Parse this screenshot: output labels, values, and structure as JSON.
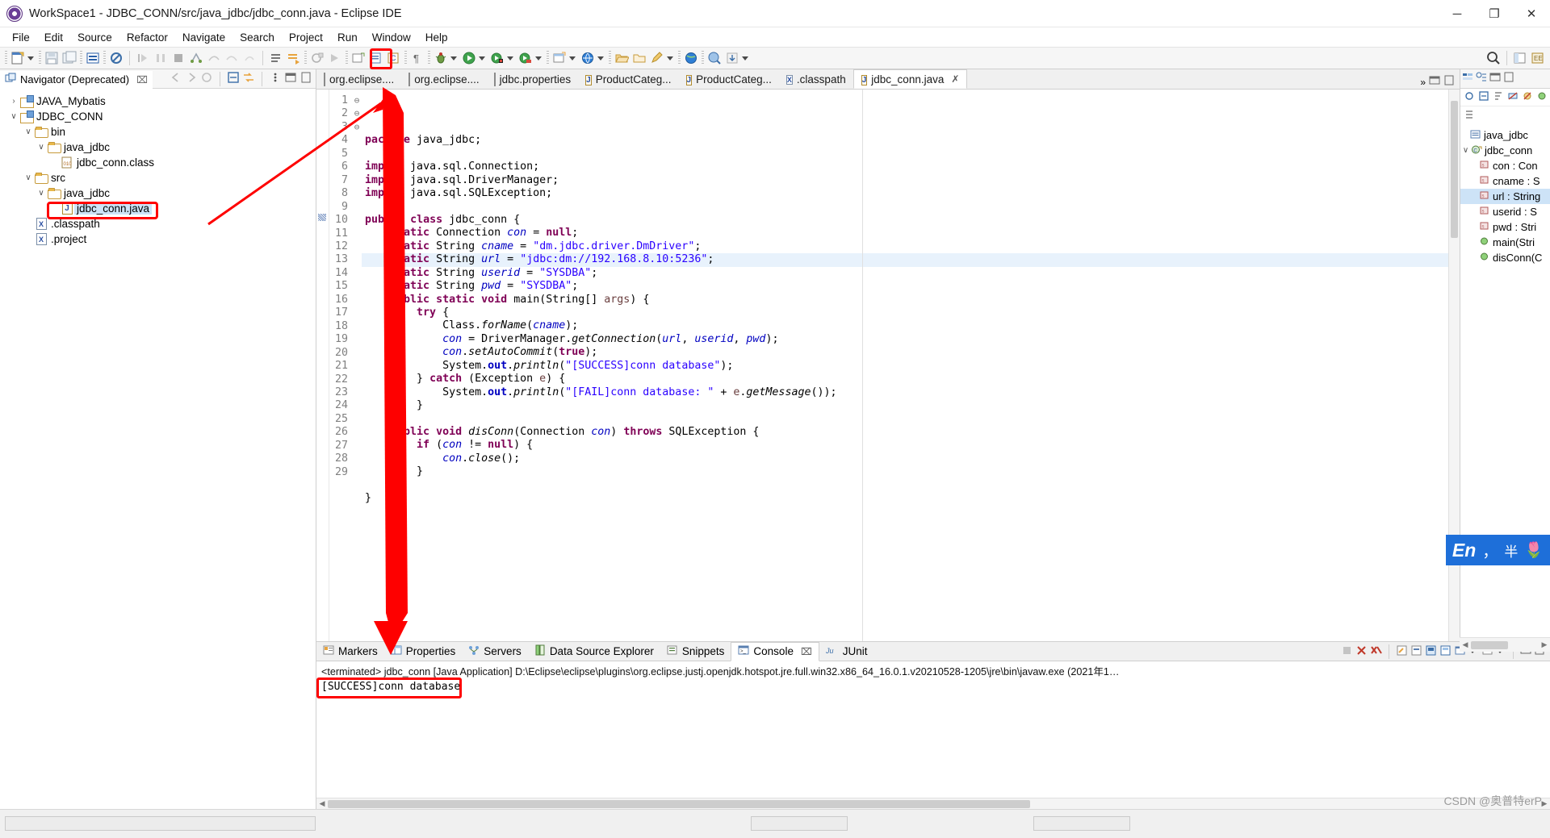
{
  "window": {
    "title": "WorkSpace1 - JDBC_CONN/src/java_jdbc/jdbc_conn.java - Eclipse IDE",
    "minimize": "─",
    "maximize": "❐",
    "close": "✕"
  },
  "menubar": [
    {
      "label": "File"
    },
    {
      "label": "Edit"
    },
    {
      "label": "Source"
    },
    {
      "label": "Refactor"
    },
    {
      "label": "Navigate"
    },
    {
      "label": "Search"
    },
    {
      "label": "Project"
    },
    {
      "label": "Run"
    },
    {
      "label": "Window"
    },
    {
      "label": "Help"
    }
  ],
  "toolbar": {
    "highlight_color": "#fe0000",
    "items": [
      {
        "name": "new-wizard-icon"
      },
      {
        "name": "save-icon"
      },
      {
        "name": "save-all-icon"
      },
      {
        "name": "print-icon"
      },
      {
        "name": "undo-icon"
      },
      {
        "name": "redo-icon"
      },
      {
        "name": "debug-icon"
      },
      {
        "name": "run-icon"
      },
      {
        "name": "run-external-tools-icon"
      },
      {
        "name": "new-java-project-icon"
      },
      {
        "name": "new-class-icon"
      },
      {
        "name": "open-type-icon"
      },
      {
        "name": "search-icon"
      }
    ]
  },
  "navigator": {
    "tab_label": "Navigator (Deprecated)",
    "close_glyph": "⌧",
    "tree": [
      {
        "label": "JAVA_Mybatis",
        "depth": 0,
        "twist": "›",
        "icon": "project-icon",
        "selected": false
      },
      {
        "label": "JDBC_CONN",
        "depth": 0,
        "twist": "∨",
        "icon": "project-icon",
        "selected": false
      },
      {
        "label": "bin",
        "depth": 1,
        "twist": "∨",
        "icon": "folder-icon",
        "selected": false
      },
      {
        "label": "java_jdbc",
        "depth": 2,
        "twist": "∨",
        "icon": "folder-icon",
        "selected": false
      },
      {
        "label": "jdbc_conn.class",
        "depth": 3,
        "twist": "",
        "icon": "class-file-icon",
        "selected": false
      },
      {
        "label": "src",
        "depth": 1,
        "twist": "∨",
        "icon": "folder-icon",
        "selected": false
      },
      {
        "label": "java_jdbc",
        "depth": 2,
        "twist": "∨",
        "icon": "folder-icon",
        "selected": false
      },
      {
        "label": "jdbc_conn.java",
        "depth": 3,
        "twist": "",
        "icon": "java-file-icon",
        "selected": true
      },
      {
        "label": ".classpath",
        "depth": 1,
        "twist": "",
        "icon": "xml-file-icon",
        "selected": false
      },
      {
        "label": ".project",
        "depth": 1,
        "twist": "",
        "icon": "xml-file-icon",
        "selected": false
      }
    ]
  },
  "editor": {
    "tabs": [
      {
        "label": "org.eclipse....",
        "icon": "text-file-icon",
        "active": false
      },
      {
        "label": "org.eclipse....",
        "icon": "text-file-icon",
        "active": false
      },
      {
        "label": "jdbc.properties",
        "icon": "text-file-icon",
        "active": false
      },
      {
        "label": "ProductCateg...",
        "icon": "java-file-icon",
        "active": false
      },
      {
        "label": "ProductCateg...",
        "icon": "java-file-icon",
        "active": false
      },
      {
        "label": ".classpath",
        "icon": "xml-file-icon",
        "active": false
      },
      {
        "label": "jdbc_conn.java",
        "icon": "java-file-icon",
        "active": true
      }
    ],
    "overflow_label": "»",
    "highlighted_line": 10,
    "lines": [
      {
        "n": 1,
        "fold": "",
        "text": "package java_jdbc;"
      },
      {
        "n": 2,
        "fold": "",
        "text": ""
      },
      {
        "n": 3,
        "fold": "⊖",
        "text": "import java.sql.Connection;"
      },
      {
        "n": 4,
        "fold": "",
        "text": "import java.sql.DriverManager;"
      },
      {
        "n": 5,
        "fold": "",
        "text": "import java.sql.SQLException;"
      },
      {
        "n": 6,
        "fold": "",
        "text": ""
      },
      {
        "n": 7,
        "fold": "",
        "text": "public class jdbc_conn {"
      },
      {
        "n": 8,
        "fold": "",
        "text": "    static Connection con = null;"
      },
      {
        "n": 9,
        "fold": "",
        "text": "    static String cname = \"dm.jdbc.driver.DmDriver\";"
      },
      {
        "n": 10,
        "fold": "",
        "text": "    static String url = \"jdbc:dm://192.168.8.10:5236\";"
      },
      {
        "n": 11,
        "fold": "",
        "text": "    static String userid = \"SYSDBA\";"
      },
      {
        "n": 12,
        "fold": "",
        "text": "    static String pwd = \"SYSDBA\";"
      },
      {
        "n": 13,
        "fold": "⊖",
        "text": "    public static void main(String[] args) {"
      },
      {
        "n": 14,
        "fold": "",
        "text": "        try {"
      },
      {
        "n": 15,
        "fold": "",
        "text": "            Class.forName(cname);"
      },
      {
        "n": 16,
        "fold": "",
        "text": "            con = DriverManager.getConnection(url, userid, pwd);"
      },
      {
        "n": 17,
        "fold": "",
        "text": "            con.setAutoCommit(true);"
      },
      {
        "n": 18,
        "fold": "",
        "text": "            System.out.println(\"[SUCCESS]conn database\");"
      },
      {
        "n": 19,
        "fold": "",
        "text": "        } catch (Exception e) {"
      },
      {
        "n": 20,
        "fold": "",
        "text": "            System.out.println(\"[FAIL]conn database: \" + e.getMessage());"
      },
      {
        "n": 21,
        "fold": "",
        "text": "        }"
      },
      {
        "n": 22,
        "fold": "",
        "text": "    }"
      },
      {
        "n": 23,
        "fold": "⊖",
        "text": "    public void disConn(Connection con) throws SQLException {"
      },
      {
        "n": 24,
        "fold": "",
        "text": "        if (con != null) {"
      },
      {
        "n": 25,
        "fold": "",
        "text": "            con.close();"
      },
      {
        "n": 26,
        "fold": "",
        "text": "        }"
      },
      {
        "n": 27,
        "fold": "",
        "text": "    }"
      },
      {
        "n": 28,
        "fold": "",
        "text": "}"
      },
      {
        "n": 29,
        "fold": "",
        "text": ""
      }
    ]
  },
  "outline": {
    "items": [
      {
        "label": "java_jdbc",
        "depth": 0,
        "icon": "package-icon",
        "twist": "",
        "selected": false
      },
      {
        "label": "jdbc_conn",
        "depth": 0,
        "icon": "class-icon",
        "twist": "∨",
        "selected": false
      },
      {
        "label": "con : Con",
        "depth": 1,
        "icon": "field-icon",
        "twist": "",
        "selected": false
      },
      {
        "label": "cname : S",
        "depth": 1,
        "icon": "field-icon",
        "twist": "",
        "selected": false
      },
      {
        "label": "url : String",
        "depth": 1,
        "icon": "field-icon",
        "twist": "",
        "selected": true
      },
      {
        "label": "userid : S",
        "depth": 1,
        "icon": "field-icon",
        "twist": "",
        "selected": false
      },
      {
        "label": "pwd : Stri",
        "depth": 1,
        "icon": "field-icon",
        "twist": "",
        "selected": false
      },
      {
        "label": "main(Stri",
        "depth": 1,
        "icon": "method-icon",
        "twist": "",
        "selected": false
      },
      {
        "label": "disConn(C",
        "depth": 1,
        "icon": "method-icon",
        "twist": "",
        "selected": false
      }
    ]
  },
  "bottom_panel": {
    "tabs": [
      {
        "label": "Markers",
        "icon": "markers-icon",
        "active": false
      },
      {
        "label": "Properties",
        "icon": "properties-icon",
        "active": false
      },
      {
        "label": "Servers",
        "icon": "servers-icon",
        "active": false
      },
      {
        "label": "Data Source Explorer",
        "icon": "data-source-icon",
        "active": false
      },
      {
        "label": "Snippets",
        "icon": "snippets-icon",
        "active": false
      },
      {
        "label": "Console",
        "icon": "console-icon",
        "active": true
      },
      {
        "label": "JUnit",
        "icon": "junit-icon",
        "active": false
      }
    ],
    "console_close_glyph": "⌧",
    "console_header": "<terminated> jdbc_conn [Java Application] D:\\Eclipse\\eclipse\\plugins\\org.eclipse.justj.openjdk.hotspot.jre.full.win32.x86_64_16.0.1.v20210528-1205\\jre\\bin\\javaw.exe  (2021年1…",
    "console_output": "[SUCCESS]conn database",
    "output_highlight_color": "#fe0000"
  },
  "ime": {
    "lang": "En",
    "comma": "，",
    "width_mode": "半",
    "flower": "🌷"
  },
  "watermark": "CSDN @奥普特erP"
}
